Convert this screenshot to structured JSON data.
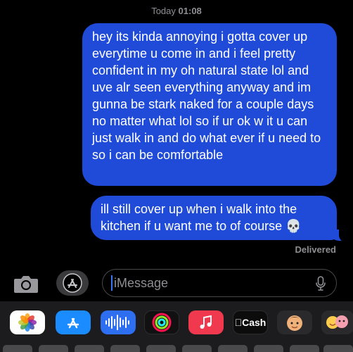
{
  "header": {
    "day": "Today",
    "time": "01:08"
  },
  "messages": [
    {
      "text": "hey its kinda annoying i gotta cover up everytime u come in and i feel pretty confident in my oh natural state lol and uve alr seen everything anyway and im gunna be stark naked for a couple days no matter what lol so if ur ok w it u can just walk in and do what ever if u need to so i can be comfortable"
    },
    {
      "text": "ill still cover up when i walk into the kitchen if u want me to of course 💀"
    }
  ],
  "status": "Delivered",
  "composer": {
    "placeholder": "iMessage",
    "camera_icon": "camera-icon",
    "apps_icon": "app-store-icon",
    "mic_icon": "microphone-icon"
  },
  "app_tray": {
    "cash_label": "Cash",
    "apps": [
      "photos-icon",
      "app-store-icon",
      "audio-message-icon",
      "fitness-icon",
      "music-icon",
      "apple-cash-icon",
      "memoji-icon",
      "memoji-stickers-icon"
    ]
  },
  "colors": {
    "bubble": "#1f4bd8",
    "background": "#000000",
    "tray": "#1c1c1e"
  }
}
